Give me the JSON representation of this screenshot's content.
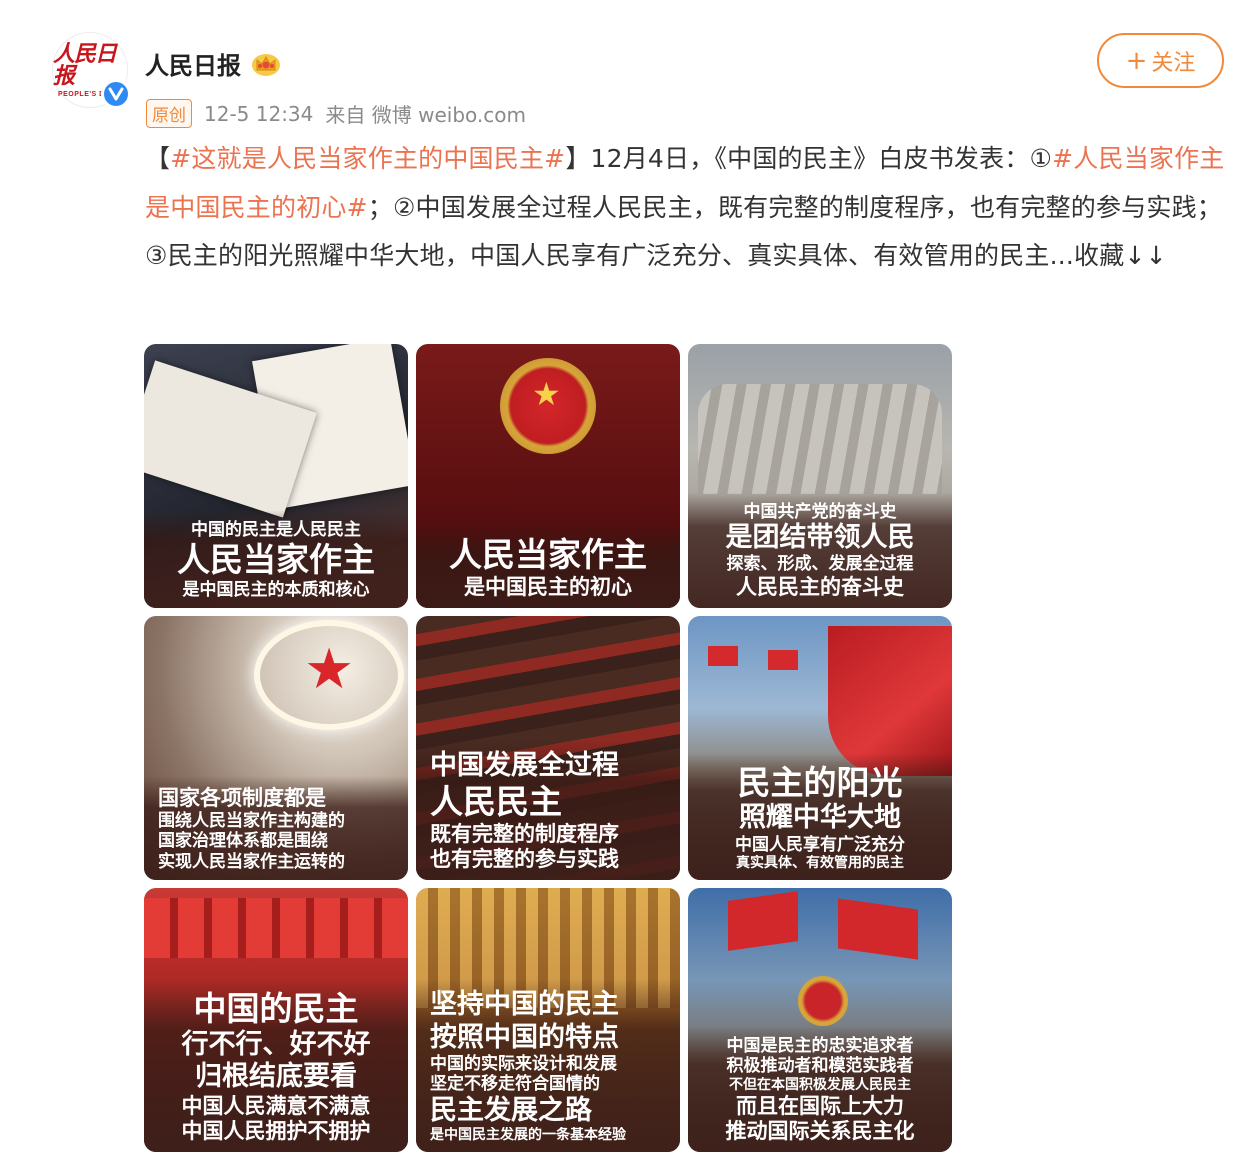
{
  "account": {
    "name": "人民日报",
    "avatar_logo": "人民日报",
    "avatar_subtitle": "PEOPLE'S DAILY",
    "verified_icon": "verified-v-icon",
    "crown_icon": "crown-icon"
  },
  "follow_button": {
    "plus": "+",
    "label": "关注"
  },
  "meta": {
    "badge": "原创",
    "time": "12-5 12:34",
    "source": "来自 微博 weibo.com"
  },
  "post": {
    "bracket_open": "【",
    "tag1": "#这就是人民当家作主的中国民主#",
    "text1": "】12月4日，《中国的民主》白皮书发表：①",
    "tag2": "#人民当家作主是中国民主的初心#",
    "text2": "；②中国发展全过程人民民主，既有完整的制度程序，也有完整的参与实践；③民主的阳光照耀中华大地，中国人民享有广泛充分、真实具体、有效管用的民主...收藏↓↓"
  },
  "images": [
    {
      "lines": [
        "中国的民主是人民民主",
        "人民当家作主",
        "是中国民主的本质和核心"
      ]
    },
    {
      "lines": [
        "人民当家作主",
        "是中国民主的初心"
      ]
    },
    {
      "lines": [
        "中国共产党的奋斗史",
        "是团结带领人民",
        "探索、形成、发展全过程",
        "人民民主的奋斗史"
      ]
    },
    {
      "lines": [
        "国家各项制度都是",
        "围绕人民当家作主构建的",
        "国家治理体系都是围绕",
        "实现人民当家作主运转的"
      ]
    },
    {
      "lines": [
        "中国发展全过程",
        "人民民主",
        "既有完整的制度程序",
        "也有完整的参与实践"
      ]
    },
    {
      "lines": [
        "民主的阳光",
        "照耀中华大地",
        "中国人民享有广泛充分",
        "真实具体、有效管用的民主"
      ]
    },
    {
      "lines": [
        "中国的民主",
        "行不行、好不好",
        "归根结底要看",
        "中国人民满意不满意",
        "中国人民拥护不拥护"
      ]
    },
    {
      "lines": [
        "坚持中国的民主",
        "按照中国的特点",
        "中国的实际来设计和发展",
        "坚定不移走符合国情的",
        "民主发展之路",
        "是中国民主发展的一条基本经验"
      ]
    },
    {
      "lines": [
        "中国是民主的忠实追求者",
        "积极推动者和模范实践者",
        "不但在本国积极发展人民民主",
        "而且在国际上大力",
        "推动国际关系民主化"
      ]
    }
  ]
}
